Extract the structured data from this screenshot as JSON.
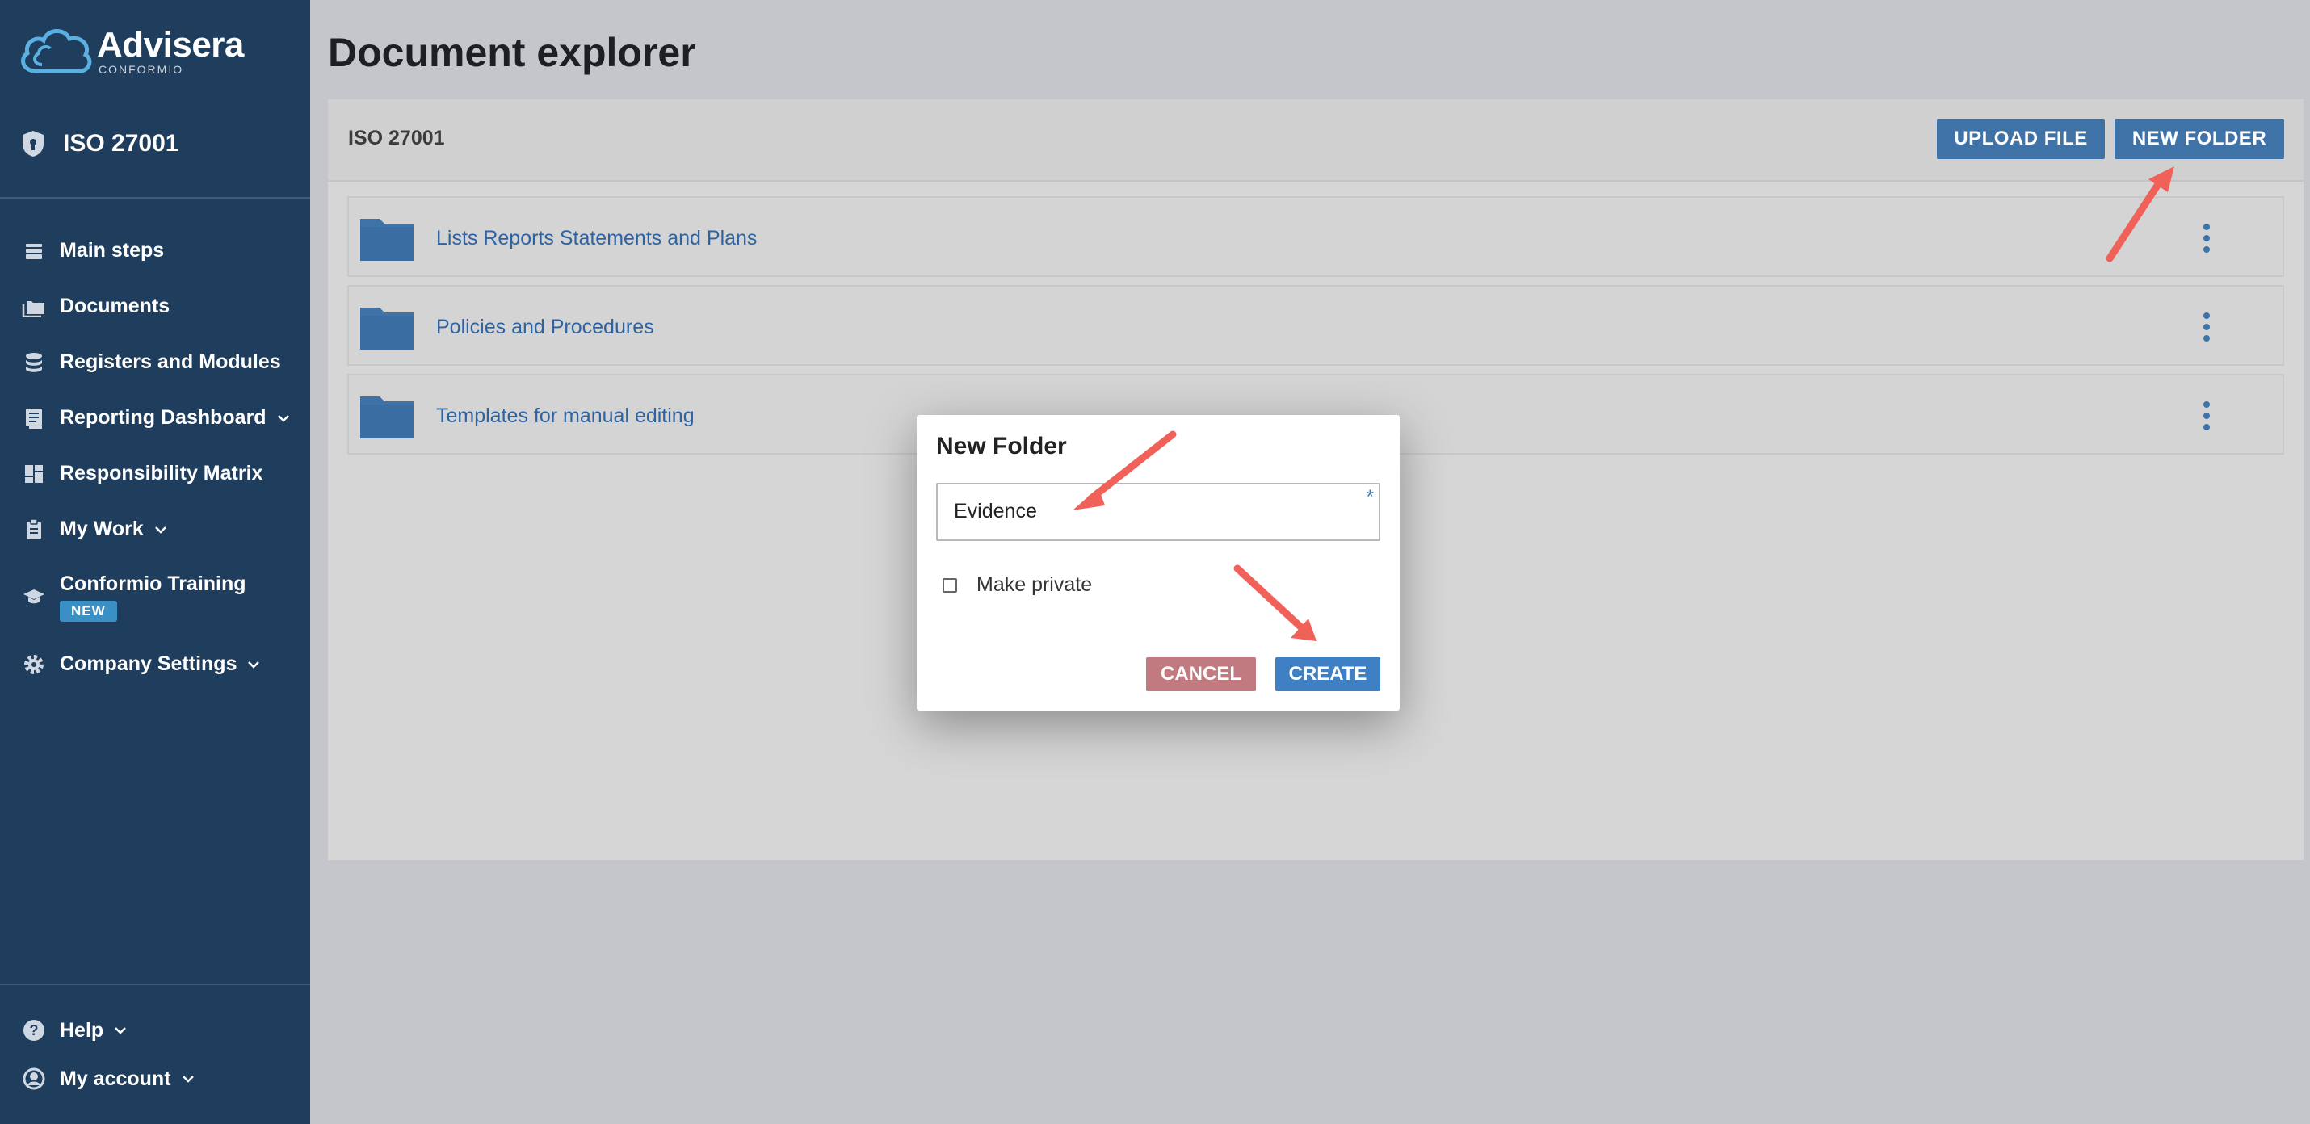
{
  "brand": {
    "name": "Advisera",
    "sub": "CONFORMIO"
  },
  "product": {
    "label": "ISO 27001"
  },
  "sidebar": {
    "items": [
      {
        "label": "Main steps",
        "icon": "layers-icon"
      },
      {
        "label": "Documents",
        "icon": "folders-icon"
      },
      {
        "label": "Registers and Modules",
        "icon": "database-icon"
      },
      {
        "label": "Reporting Dashboard",
        "icon": "report-icon",
        "chevron": true
      },
      {
        "label": "Responsibility Matrix",
        "icon": "grid-icon"
      },
      {
        "label": "My Work",
        "icon": "clipboard-icon",
        "chevron": true
      },
      {
        "label": "Conformio Training",
        "icon": "graduation-cap-icon",
        "badge": "NEW"
      },
      {
        "label": "Company Settings",
        "icon": "gear-icon",
        "chevron": true
      }
    ],
    "bottom": [
      {
        "label": "Help",
        "icon": "help-icon"
      },
      {
        "label": "My account",
        "icon": "account-icon"
      }
    ]
  },
  "main": {
    "title": "Document explorer",
    "breadcrumb": "ISO 27001",
    "upload_label": "UPLOAD FILE",
    "new_folder_label": "NEW FOLDER",
    "folders": [
      {
        "name": "Lists Reports Statements and Plans"
      },
      {
        "name": "Policies and Procedures"
      },
      {
        "name": "Templates for manual editing"
      }
    ]
  },
  "dialog": {
    "title": "New Folder",
    "input_value": "Evidence",
    "required_marker": "*",
    "checkbox_label": "Make private",
    "cancel_label": "CANCEL",
    "create_label": "CREATE"
  },
  "colors": {
    "sidebar": "#1f3d5c",
    "primary": "#3f73a8",
    "cancel": "#c07a80",
    "annotation_arrow": "#f0615a"
  }
}
